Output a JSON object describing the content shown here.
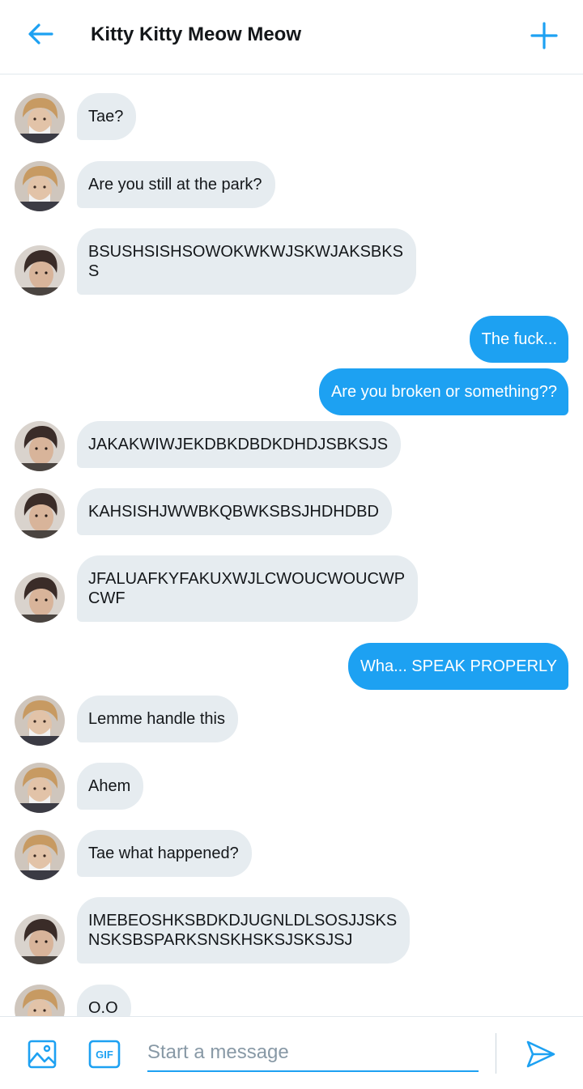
{
  "header": {
    "title": "Kitty Kitty Meow Meow",
    "back_icon": "arrow-left-icon",
    "new_icon": "plus-icon",
    "accent": "#1da1f2"
  },
  "messages": [
    {
      "side": "received",
      "sender": "blonde",
      "text": "Tae?"
    },
    {
      "side": "received",
      "sender": "blonde",
      "text": "Are you still at the park?"
    },
    {
      "side": "received",
      "sender": "dark",
      "text": "BSUSHSISHSOWOKWKWJSKWJAKSBKS\nS"
    },
    {
      "side": "sent",
      "text": "The fuck..."
    },
    {
      "side": "sent",
      "text": "Are you broken or something??"
    },
    {
      "side": "received",
      "sender": "dark",
      "text": "JAKAKWIWJEKDBKDBDKDHDJSBKSJS"
    },
    {
      "side": "received",
      "sender": "dark",
      "text": "KAHSISHJWWBKQBWKSBSJHDHDBD"
    },
    {
      "side": "received",
      "sender": "dark",
      "text": "JFALUAFKYFAKUXWJLCWOUCWOUCWP\nCWF"
    },
    {
      "side": "sent",
      "text": "Wha... SPEAK PROPERLY"
    },
    {
      "side": "received",
      "sender": "blonde",
      "text": "Lemme handle this"
    },
    {
      "side": "received",
      "sender": "blonde",
      "text": "Ahem"
    },
    {
      "side": "received",
      "sender": "blonde",
      "text": "Tae what happened?"
    },
    {
      "side": "received",
      "sender": "dark",
      "text": "IMEBEOSHKSBDKDJUGNLDLSOSJJSKS\nNSKSBSPARKSNSKHSKSJSKSJSJ"
    },
    {
      "side": "received",
      "sender": "blonde",
      "text": "O.O"
    }
  ],
  "composer": {
    "placeholder": "Start a message",
    "image_icon": "image-icon",
    "gif_icon": "gif-icon",
    "gif_label": "GIF",
    "send_icon": "send-icon"
  },
  "colors": {
    "received_bubble": "#e6ecf0",
    "sent_bubble": "#1da1f2",
    "text": "#14171a",
    "placeholder": "#8899a6"
  }
}
